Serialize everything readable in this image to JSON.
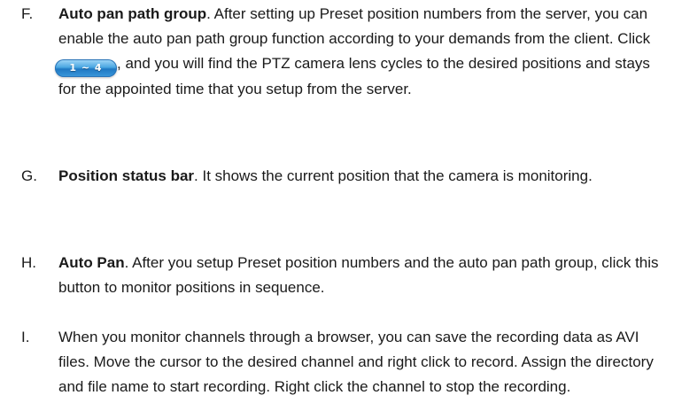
{
  "items": [
    {
      "marker": "F.",
      "title": "Auto pan path group",
      "text_before_button": ". After setting up Preset position numbers from the server, you can enable the auto pan path group function according to your demands from the client. Click",
      "button_label": "1 ~ 4",
      "text_after_button": ", and you will find the PTZ camera lens cycles to the desired positions and stays for the appointed time that you setup from the server."
    },
    {
      "marker": "G.",
      "title": "Position status bar",
      "text": ". It shows the current position that the camera is monitoring."
    },
    {
      "marker": "H.",
      "title": "Auto Pan",
      "text": ". After you setup Preset position numbers and the auto pan path group, click this button to monitor positions in sequence."
    },
    {
      "marker": "I.",
      "text": "When you monitor channels through a browser, you can save the recording data as AVI files. Move the cursor to the desired channel and right click to record. Assign the directory and file name to start recording. Right click the channel to stop the recording."
    }
  ]
}
